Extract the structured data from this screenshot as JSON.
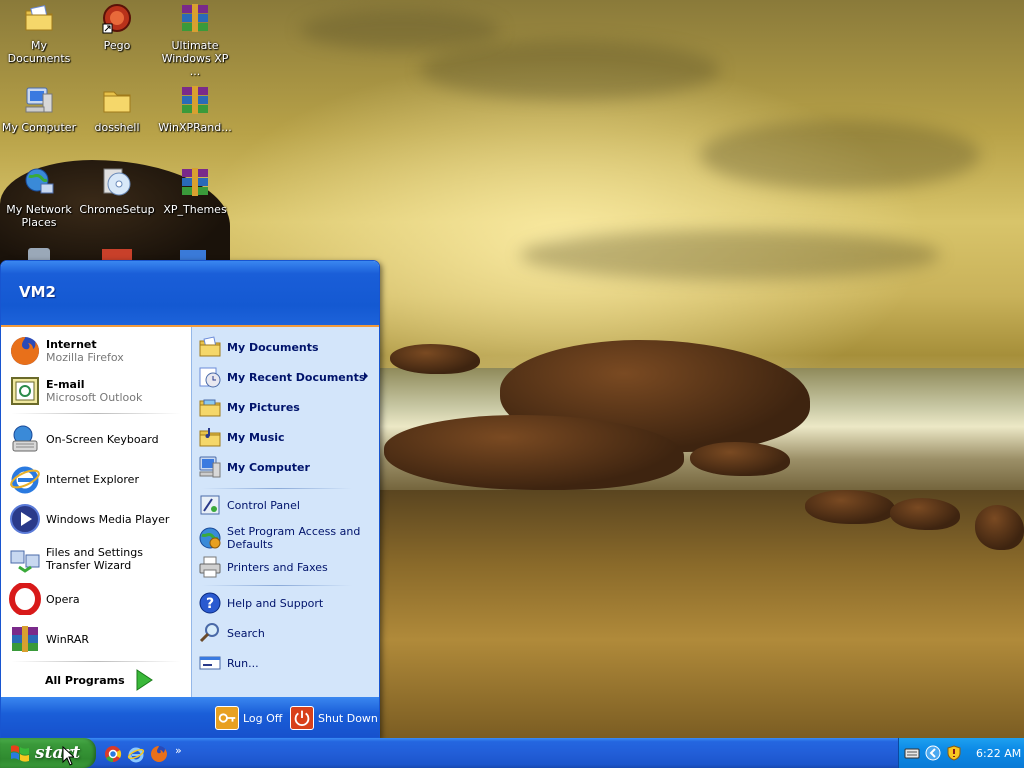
{
  "desktop": {
    "icons": [
      {
        "label": "My Documents",
        "icon": "folder-documents-icon"
      },
      {
        "label": "Pego",
        "icon": "pego-app-icon"
      },
      {
        "label": "Ultimate Windows XP ...",
        "icon": "winrar-archive-icon"
      },
      {
        "label": "My Computer",
        "icon": "computer-icon"
      },
      {
        "label": "dosshell",
        "icon": "folder-icon"
      },
      {
        "label": "WinXPRand...",
        "icon": "winrar-archive-icon"
      },
      {
        "label": "My Network Places",
        "icon": "network-places-icon"
      },
      {
        "label": "ChromeSetup",
        "icon": "cd-setup-icon"
      },
      {
        "label": "XP_Themes",
        "icon": "winrar-archive-icon"
      }
    ]
  },
  "start_menu": {
    "user_name": "VM2",
    "pinned": [
      {
        "title": "Internet",
        "subtitle": "Mozilla Firefox",
        "icon": "firefox-icon"
      },
      {
        "title": "E-mail",
        "subtitle": "Microsoft Outlook",
        "icon": "outlook-icon"
      }
    ],
    "recent": [
      {
        "label": "On-Screen Keyboard",
        "icon": "keyboard-icon"
      },
      {
        "label": "Internet Explorer",
        "icon": "internet-explorer-icon"
      },
      {
        "label": "Windows Media Player",
        "icon": "media-player-icon"
      },
      {
        "label": "Files and Settings Transfer Wizard",
        "icon": "transfer-wizard-icon"
      },
      {
        "label": "Opera",
        "icon": "opera-icon"
      },
      {
        "label": "WinRAR",
        "icon": "winrar-icon"
      }
    ],
    "all_programs_label": "All Programs",
    "places": [
      {
        "label": "My Documents",
        "icon": "folder-documents-icon"
      },
      {
        "label": "My Recent Documents",
        "icon": "recent-documents-icon"
      },
      {
        "label": "My Pictures",
        "icon": "folder-pictures-icon"
      },
      {
        "label": "My Music",
        "icon": "folder-music-icon"
      },
      {
        "label": "My Computer",
        "icon": "computer-icon"
      }
    ],
    "settings": [
      {
        "label": "Control Panel",
        "icon": "control-panel-icon"
      },
      {
        "label": "Set Program Access and Defaults",
        "icon": "program-access-icon"
      },
      {
        "label": "Printers and Faxes",
        "icon": "printer-icon"
      }
    ],
    "help": [
      {
        "label": "Help and Support",
        "icon": "help-icon"
      },
      {
        "label": "Search",
        "icon": "search-icon"
      },
      {
        "label": "Run...",
        "icon": "run-icon"
      }
    ],
    "footer": {
      "log_off": "Log Off",
      "shut_down": "Shut Down"
    }
  },
  "taskbar": {
    "start_label": "start",
    "quick_launch_chevron": "»",
    "clock": "6:22 AM"
  },
  "colors": {
    "xp_blue": "#1a5ed8",
    "start_green": "#3a9a3a",
    "menu_right_bg": "#d3e5fa",
    "header_accent": "#f39b3b"
  }
}
